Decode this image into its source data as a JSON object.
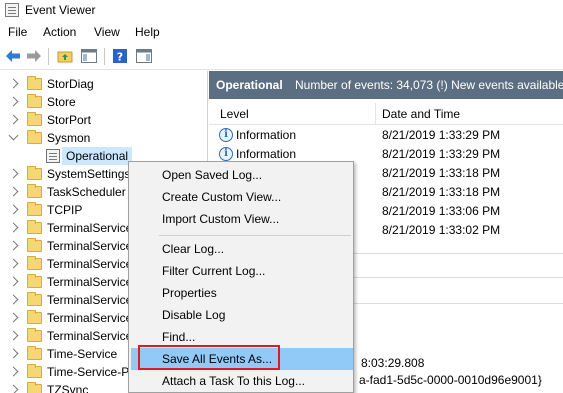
{
  "window": {
    "title": "Event Viewer"
  },
  "menu": [
    "File",
    "Action",
    "View",
    "Help"
  ],
  "toolbar": {
    "icons": [
      "back-arrow-icon",
      "forward-arrow-icon",
      "folder-up-icon",
      "show-hide-tree-icon",
      "help-icon",
      "show-hide-action-pane-icon"
    ]
  },
  "tree": {
    "items": [
      {
        "label": "StorDiag",
        "expanded": false
      },
      {
        "label": "Store",
        "expanded": false
      },
      {
        "label": "StorPort",
        "expanded": false
      },
      {
        "label": "Sysmon",
        "expanded": true
      },
      {
        "label": "Operational",
        "child": true,
        "selected": true
      },
      {
        "label": "SystemSettings",
        "expanded": false
      },
      {
        "label": "TaskScheduler",
        "expanded": false
      },
      {
        "label": "TCPIP",
        "expanded": false
      },
      {
        "label": "TerminalServices",
        "expanded": false
      },
      {
        "label": "TerminalServices",
        "expanded": false
      },
      {
        "label": "TerminalServices",
        "expanded": false
      },
      {
        "label": "TerminalServices",
        "expanded": false
      },
      {
        "label": "TerminalServices",
        "expanded": false
      },
      {
        "label": "TerminalServices",
        "expanded": false
      },
      {
        "label": "TerminalServices",
        "expanded": false
      },
      {
        "label": "Time-Service",
        "expanded": false
      },
      {
        "label": "Time-Service-P",
        "expanded": false
      },
      {
        "label": "TZSync",
        "expanded": false
      }
    ]
  },
  "pane": {
    "title": "Operational",
    "count_text": "Number of events: 34,073 (!) New events available",
    "columns": {
      "level": "Level",
      "date": "Date and Time"
    },
    "rows": [
      {
        "level": "Information",
        "date": "8/21/2019 1:33:29 PM"
      },
      {
        "level": "Information",
        "date": "8/21/2019 1:33:29 PM"
      },
      {
        "level": "",
        "date": "8/21/2019 1:33:18 PM"
      },
      {
        "level": "",
        "date": "8/21/2019 1:33:18 PM"
      },
      {
        "level": "",
        "date": "8/21/2019 1:33:06 PM"
      },
      {
        "level": "",
        "date": "8/21/2019 1:33:02 PM"
      }
    ],
    "detail": {
      "line1": "8:03:29.808",
      "line2": "a-fad1-5d5c-0000-0010d96e9001}"
    }
  },
  "context_menu": {
    "items": [
      {
        "label": "Open Saved Log...",
        "group": 1
      },
      {
        "label": "Create Custom View...",
        "group": 1
      },
      {
        "label": "Import Custom View...",
        "group": 1
      },
      {
        "label": "Clear Log...",
        "group": 2
      },
      {
        "label": "Filter Current Log...",
        "group": 2
      },
      {
        "label": "Properties",
        "group": 2
      },
      {
        "label": "Disable Log",
        "group": 2
      },
      {
        "label": "Find...",
        "group": 2
      },
      {
        "label": "Save All Events As...",
        "group": 2,
        "highlighted": true
      },
      {
        "label": "Attach a Task To this Log...",
        "group": 2
      }
    ]
  },
  "colors": {
    "header_bg": "#5c6f82",
    "menu_highlight": "#91c9f7",
    "annotation_box": "#e01b24",
    "tree_selection": "#cce8ff"
  }
}
